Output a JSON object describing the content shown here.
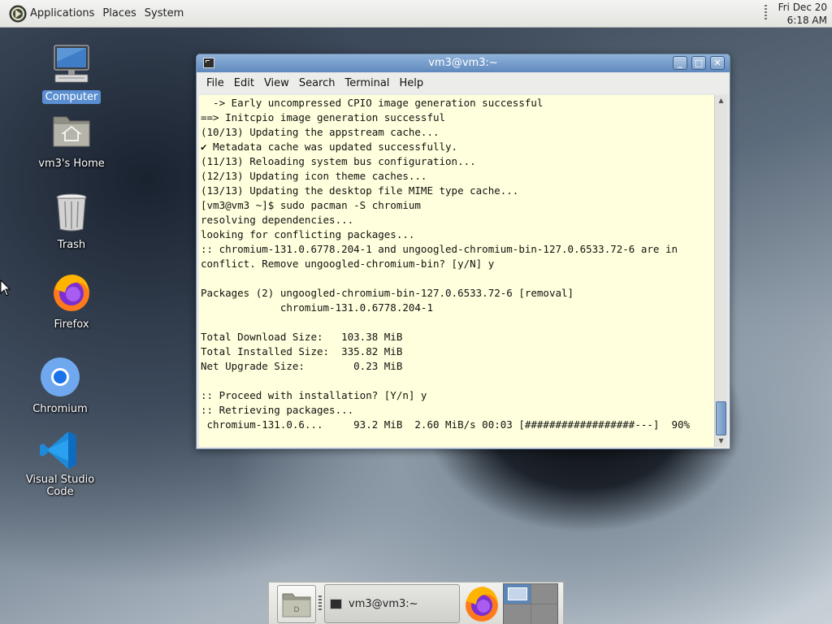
{
  "top_panel": {
    "menus": [
      "Applications",
      "Places",
      "System"
    ],
    "clock_date": "Fri Dec 20",
    "clock_time": "6:18 AM",
    "logo_icon": "system-logo-icon"
  },
  "desktop": {
    "icons": [
      {
        "label": "Computer",
        "icon": "computer-icon",
        "selected": true
      },
      {
        "label": "vm3's Home",
        "icon": "home-folder-icon"
      },
      {
        "label": "Trash",
        "icon": "trash-icon"
      },
      {
        "label": "Firefox",
        "icon": "firefox-icon"
      },
      {
        "label": "Chromium",
        "icon": "chromium-icon"
      },
      {
        "label": "Visual Studio Code",
        "icon": "vscode-icon"
      }
    ]
  },
  "terminal": {
    "title": "vm3@vm3:~",
    "menu": [
      "File",
      "Edit",
      "View",
      "Search",
      "Terminal",
      "Help"
    ],
    "background_color": "#ffffdd",
    "lines": [
      "  -> Early uncompressed CPIO image generation successful",
      "==> Initcpio image generation successful",
      "(10/13) Updating the appstream cache...",
      "✔ Metadata cache was updated successfully.",
      "(11/13) Reloading system bus configuration...",
      "(12/13) Updating icon theme caches...",
      "(13/13) Updating the desktop file MIME type cache...",
      "[vm3@vm3 ~]$ sudo pacman -S chromium",
      "resolving dependencies...",
      "looking for conflicting packages...",
      ":: chromium-131.0.6778.204-1 and ungoogled-chromium-bin-127.0.6533.72-6 are in",
      "conflict. Remove ungoogled-chromium-bin? [y/N] y",
      "",
      "Packages (2) ungoogled-chromium-bin-127.0.6533.72-6 [removal]",
      "             chromium-131.0.6778.204-1",
      "",
      "Total Download Size:   103.38 MiB",
      "Total Installed Size:  335.82 MiB",
      "Net Upgrade Size:        0.23 MiB",
      "",
      ":: Proceed with installation? [Y/n] y",
      ":: Retrieving packages...",
      " chromium-131.0.6...     93.2 MiB  2.60 MiB/s 00:03 [##################---]  90%"
    ]
  },
  "taskbar": {
    "window_button_label": "vm3@vm3:~",
    "show_desktop_icon": "show-desktop-icon",
    "launcher_icon": "firefox-icon",
    "workspaces": 4,
    "active_workspace": 1
  }
}
